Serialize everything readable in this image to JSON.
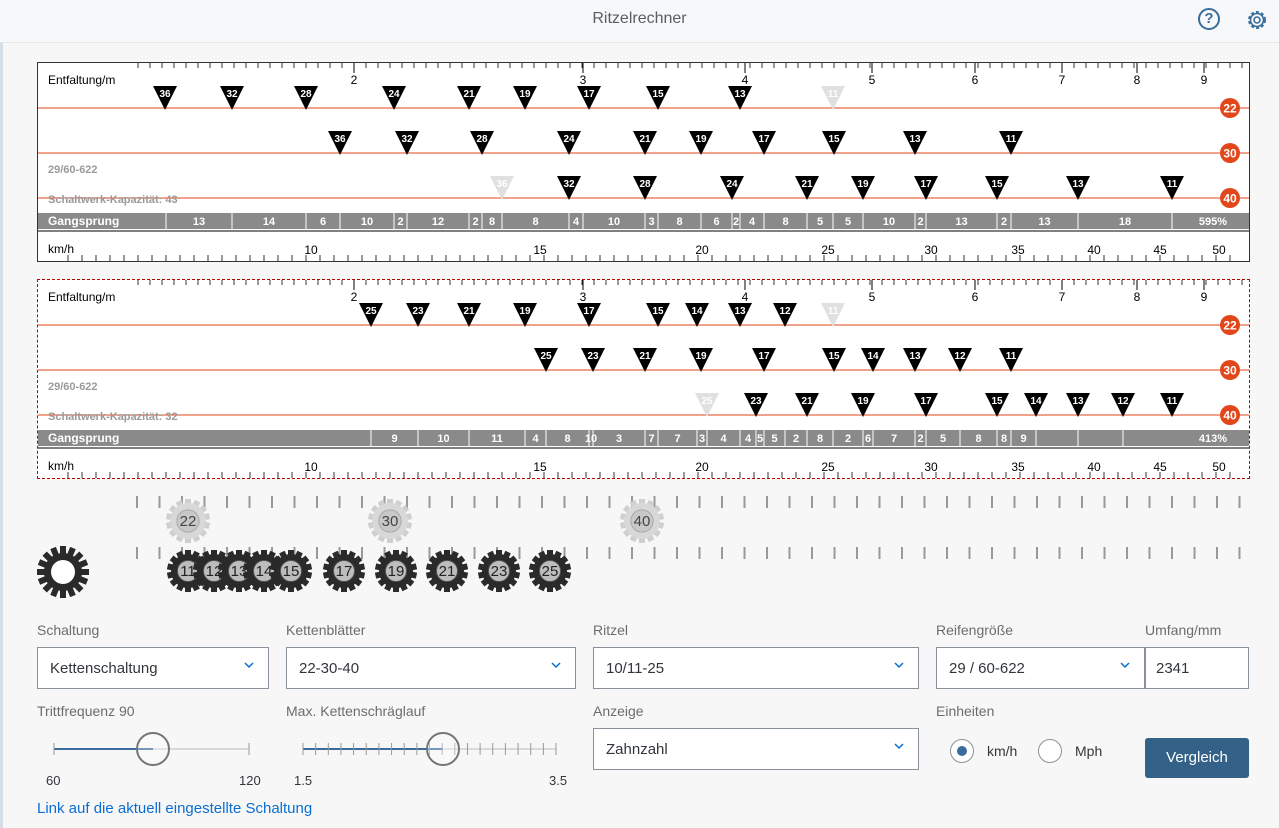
{
  "app": {
    "title": "Ritzelrechner"
  },
  "charts": [
    {
      "entf_label": "Entfaltung/m",
      "entf_ticks": [
        "2",
        "3",
        "4",
        "5",
        "6",
        "7",
        "8",
        "9"
      ],
      "rows": [
        {
          "chainring": "22",
          "cogs": [
            "36",
            "32",
            "28",
            "24",
            "21",
            "19",
            "17",
            "15",
            "13",
            "11"
          ],
          "dim": [
            false,
            false,
            false,
            false,
            false,
            false,
            false,
            false,
            false,
            true
          ]
        },
        {
          "chainring": "30",
          "cogs": [
            "36",
            "32",
            "28",
            "24",
            "21",
            "19",
            "17",
            "15",
            "13",
            "11"
          ],
          "dim": [
            false,
            false,
            false,
            false,
            false,
            false,
            false,
            false,
            false,
            false
          ]
        },
        {
          "chainring": "40",
          "cogs": [
            "36",
            "32",
            "28",
            "24",
            "21",
            "19",
            "17",
            "15",
            "13",
            "11"
          ],
          "dim": [
            true,
            false,
            false,
            false,
            false,
            false,
            false,
            false,
            false,
            false
          ]
        }
      ],
      "tire_label": "29/60-622",
      "capacity_label": "Schaltwerk-Kapazität: 43",
      "gangsprung_label": "Gangsprung",
      "gangsprung_values": [
        "13",
        "14",
        "6",
        "10",
        "2",
        "12",
        "2",
        "8",
        "8",
        "4",
        "10",
        "3",
        "8",
        "6",
        "2",
        "4",
        "8",
        "5",
        "5",
        "10",
        "2",
        "13",
        "2",
        "13",
        "18"
      ],
      "gangsprung_total": "595%",
      "kmh_label": "km/h",
      "kmh_ticks": [
        "10",
        "15",
        "20",
        "25",
        "30",
        "35",
        "40",
        "45",
        "50"
      ]
    },
    {
      "entf_label": "Entfaltung/m",
      "entf_ticks": [
        "2",
        "3",
        "4",
        "5",
        "6",
        "7",
        "8",
        "9"
      ],
      "rows": [
        {
          "chainring": "22",
          "cogs": [
            "25",
            "23",
            "21",
            "19",
            "17",
            "15",
            "14",
            "13",
            "12",
            "11"
          ],
          "dim": [
            false,
            false,
            false,
            false,
            false,
            false,
            false,
            false,
            false,
            true
          ]
        },
        {
          "chainring": "30",
          "cogs": [
            "25",
            "23",
            "21",
            "19",
            "17",
            "15",
            "14",
            "13",
            "12",
            "11"
          ],
          "dim": [
            false,
            false,
            false,
            false,
            false,
            false,
            false,
            false,
            false,
            false
          ]
        },
        {
          "chainring": "40",
          "cogs": [
            "25",
            "23",
            "21",
            "19",
            "17",
            "15",
            "14",
            "13",
            "12",
            "11"
          ],
          "dim": [
            true,
            false,
            false,
            false,
            false,
            false,
            false,
            false,
            false,
            false
          ]
        }
      ],
      "tire_label": "29/60-622",
      "capacity_label": "Schaltwerk-Kapazität: 32",
      "gangsprung_label": "Gangsprung",
      "gangsprung_values": [
        "9",
        "10",
        "11",
        "4",
        "8",
        "10",
        "3",
        "7",
        "7",
        "3",
        "4",
        "4",
        "5",
        "5",
        "2",
        "8",
        "2",
        "6",
        "7",
        "2",
        "5",
        "8",
        "8",
        "9"
      ],
      "gangsprung_total": "413%",
      "kmh_label": "km/h",
      "kmh_ticks": [
        "10",
        "15",
        "20",
        "25",
        "30",
        "35",
        "40",
        "45",
        "50"
      ]
    }
  ],
  "gear_visual": {
    "chainrings": [
      "22",
      "30",
      "40"
    ],
    "cogs": [
      "11",
      "12",
      "13",
      "14",
      "15",
      "17",
      "19",
      "21",
      "23",
      "25"
    ]
  },
  "form": {
    "schaltung": {
      "label": "Schaltung",
      "value": "Kettenschaltung"
    },
    "kettenblaetter": {
      "label": "Kettenblätter",
      "value": "22-30-40"
    },
    "ritzel": {
      "label": "Ritzel",
      "value": "10/11-25"
    },
    "reifen": {
      "label": "Reifengröße",
      "value": "29 / 60-622"
    },
    "umfang": {
      "label": "Umfang/mm",
      "value": "2341"
    },
    "trittfrequenz": {
      "label": "Trittfrequenz 90",
      "min": "60",
      "max": "120",
      "value": 90
    },
    "schraeglauf": {
      "label": "Max. Kettenschräglauf",
      "min": "1.5",
      "max": "3.5",
      "value": 2.5
    },
    "anzeige": {
      "label": "Anzeige",
      "value": "Zahnzahl"
    },
    "einheiten": {
      "label": "Einheiten",
      "option1": "km/h",
      "option2": "Mph",
      "selected": "km/h"
    },
    "vergleich_button": "Vergleich",
    "link": "Link auf die aktuell eingestellte Schaltung"
  },
  "colors": {
    "accent": "#e2461b",
    "button": "#346187",
    "slider": "#3a6d9e",
    "link": "#0a6ed1"
  }
}
